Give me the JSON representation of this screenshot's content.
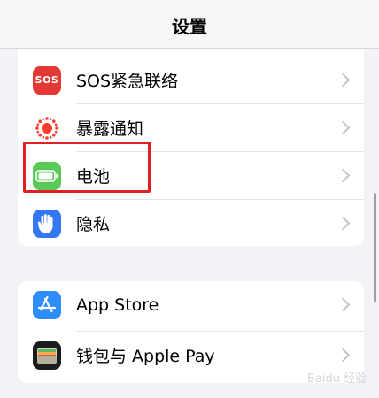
{
  "navbar": {
    "title": "设置"
  },
  "group1": {
    "rows": [
      {
        "label": "SOS紧急联络",
        "icon": "sos-icon",
        "icon_text": "SOS"
      },
      {
        "label": "暴露通知",
        "icon": "exposure-notification-icon"
      },
      {
        "label": "电池",
        "icon": "battery-icon"
      },
      {
        "label": "隐私",
        "icon": "hand-privacy-icon"
      }
    ]
  },
  "group2": {
    "rows": [
      {
        "label": "App Store",
        "icon": "app-store-icon"
      },
      {
        "label": "钱包与 Apple Pay",
        "icon": "wallet-icon"
      }
    ]
  },
  "colors": {
    "sos": "#e53935",
    "battery": "#5ac95a",
    "privacy": "#3478f6",
    "appstore": "#2f8dfb",
    "highlight": "#e02020"
  },
  "watermark": "Baidu 经验"
}
